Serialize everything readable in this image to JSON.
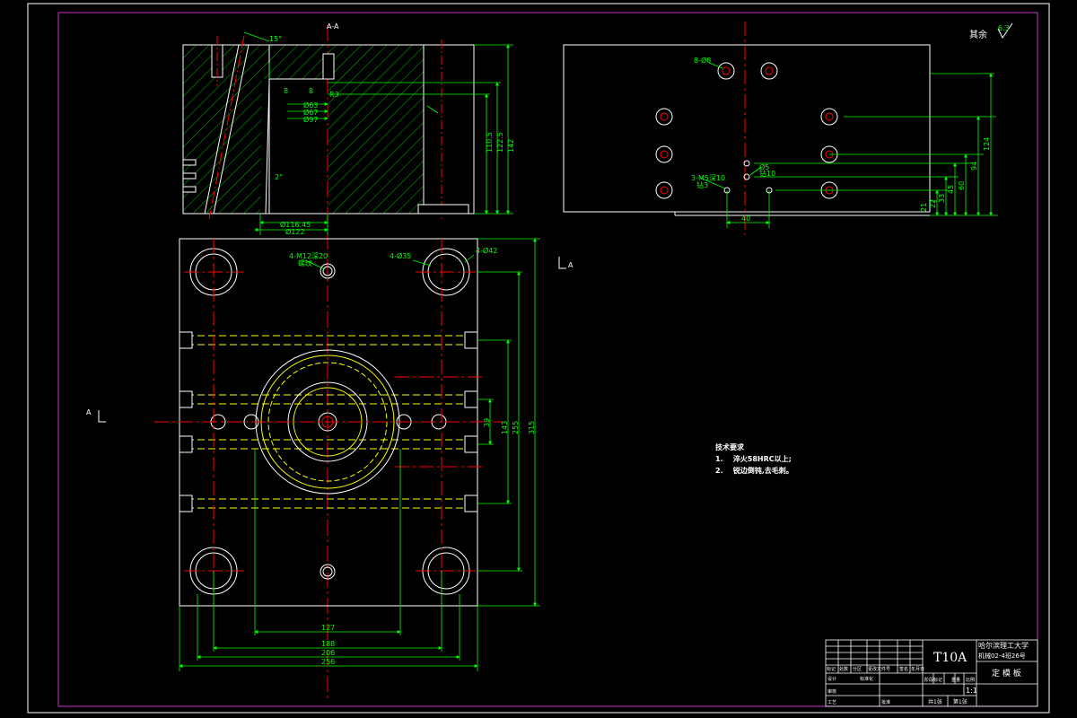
{
  "drawing": {
    "section_title": "A-A",
    "section_mark": "A",
    "surface_note_label": "其余",
    "surface_note_value": "6.3"
  },
  "tech_notes": {
    "heading": "技术要求",
    "items": [
      {
        "num": "1.",
        "text": "淬火58HRC以上;"
      },
      {
        "num": "2.",
        "text": "锐边倒钝,去毛刺。"
      }
    ]
  },
  "section_view_dims": {
    "angle_top": "15°",
    "angle_mid": "2°",
    "d1": "Ø63",
    "d2": "Ø67",
    "d3": "Ø97",
    "r1": "R3",
    "n1": "8",
    "n2": "8",
    "h1": "110.5",
    "h2": "122.5",
    "h3": "142",
    "w1": "Ø116.45",
    "w2": "Ø122"
  },
  "plan_view_dims": {
    "hole_note_1": "4-M12深20",
    "hole_note_1b": "螺纹",
    "hole_note_2": "4-Ø35",
    "hole_note_3": "4-Ø42",
    "v1": "39",
    "v2": "143",
    "v3": "255",
    "v4": "315",
    "h1": "127",
    "h2": "188",
    "h3": "206",
    "h4": "256"
  },
  "side_view_dims": {
    "hole_top": "8-Ø8",
    "hole_mid": "3-M5深10",
    "hole_mid_b": "钻3",
    "hole_small": "Ø5",
    "hole_small_b": "钻10",
    "bottom": "40",
    "r1": "124",
    "r2": "94",
    "r3": "60",
    "r4": "45",
    "r5": "33",
    "r6": "22",
    "r7": "21"
  },
  "title_block": {
    "material": "T10A",
    "school": "哈尔滨理工大学",
    "class": "机械02-4班26号",
    "part_name": "定 模 板",
    "scale": "1:1",
    "marker": "标记",
    "qty": "处数",
    "zone": "分区",
    "change_doc": "更改文件号",
    "signature": "签名",
    "date": "年月日",
    "designer": "设计",
    "standardize": "标准化",
    "stage_mark": "阶段标记",
    "weight": "重量",
    "ratio": "比例",
    "review": "审核",
    "craft": "工艺",
    "approve": "批准",
    "total_sheets": "共1张",
    "sheet_no": "第1张"
  },
  "colors": {
    "outline": "#ffffff",
    "dimension": "#00ff00",
    "center": "#ff0000",
    "hatch": "#00cc00",
    "hidden": "#ffff00",
    "frame": "#cc33cc"
  }
}
